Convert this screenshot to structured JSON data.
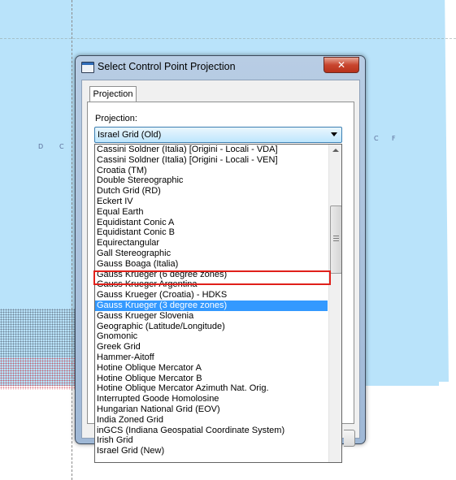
{
  "dialog": {
    "title": "Select Control Point Projection",
    "close_glyph": "✕",
    "tab_label": "Projection",
    "field_label": "Projection:",
    "selected_value": "Israel Grid (Old)"
  },
  "dropdown": {
    "items": [
      "Cassini Soldner (Italia) [Origini - Locali - VDA]",
      "Cassini Soldner (Italia) [Origini - Locali - VEN]",
      "Croatia (TM)",
      "Double Stereographic",
      "Dutch Grid (RD)",
      "Eckert IV",
      "Equal Earth",
      "Equidistant Conic A",
      "Equidistant Conic B",
      "Equirectangular",
      "Gall Stereographic",
      "Gauss Boaga (Italia)",
      "Gauss Krueger (6 degree zones)",
      "Gauss Krueger Argentina",
      "Gauss Krueger (Croatia) - HDKS",
      "Gauss Krueger (3 degree zones)",
      "Gauss Krueger Slovenia",
      "Geographic (Latitude/Longitude)",
      "Gnomonic",
      "Greek Grid",
      "Hammer-Aitoff",
      "Hotine Oblique Mercator A",
      "Hotine Oblique Mercator B",
      "Hotine Oblique Mercator Azimuth Nat. Orig.",
      "Interrupted Goode Homolosine",
      "Hungarian National Grid (EOV)",
      "India Zoned Grid",
      "inGCS (Indiana Geospatial Coordinate System)",
      "Irish Grid",
      "Israel Grid (New)"
    ],
    "highlighted_item": "Gauss Krueger (3 degree zones)",
    "outlined_item": "Gauss Krueger (6 degree zones)"
  },
  "map": {
    "labels": [
      "D",
      "C",
      "C",
      "F"
    ]
  },
  "colors": {
    "water": "#b9e3fa",
    "selection": "#3399ff",
    "annotation_outline": "#e0201a"
  }
}
